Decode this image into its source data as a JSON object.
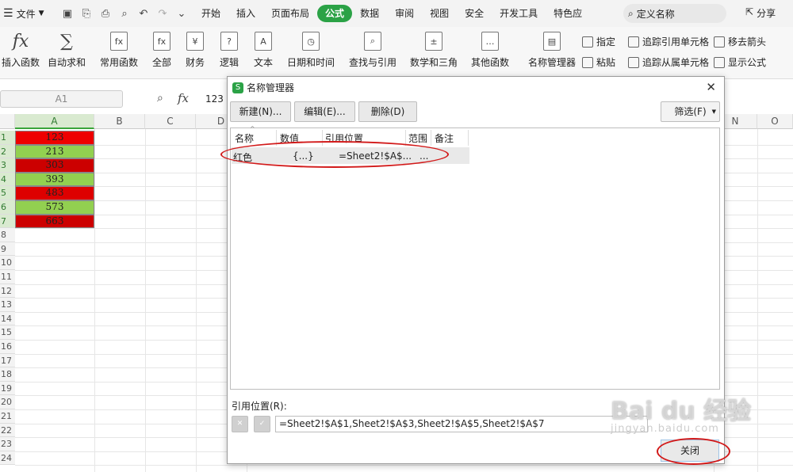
{
  "menubar": {
    "file_label": "文件",
    "tabs": [
      "开始",
      "插入",
      "页面布局",
      "公式",
      "数据",
      "审阅",
      "视图",
      "安全",
      "开发工具",
      "特色应"
    ],
    "active_tab": "公式",
    "search_placeholder": "定义名称",
    "share_label": "分享"
  },
  "ribbon": {
    "buttons": [
      "插入函数",
      "自动求和",
      "常用函数",
      "全部",
      "财务",
      "逻辑",
      "文本",
      "日期和时间",
      "查找与引用",
      "数学和三角",
      "其他函数",
      "名称管理器"
    ],
    "small": [
      "指定",
      "粘贴",
      "追踪引用单元格",
      "追踪从属单元格",
      "移去箭头",
      "显示公式"
    ],
    "fx_glyph": "fx",
    "sum_glyph": "∑"
  },
  "formula_bar": {
    "name_box": "A1",
    "fx_label": "fx",
    "value": "123"
  },
  "sheet": {
    "columns": [
      "A",
      "B",
      "C",
      "D",
      "N",
      "O"
    ],
    "rows": [
      "1",
      "2",
      "3",
      "4",
      "5",
      "6",
      "7",
      "8",
      "9",
      "10",
      "11",
      "12",
      "13",
      "14",
      "15",
      "16",
      "17",
      "18",
      "19",
      "20",
      "21",
      "22",
      "23",
      "24"
    ],
    "cells": [
      {
        "value": "123",
        "color": "#ee0000"
      },
      {
        "value": "213",
        "color": "#92d050"
      },
      {
        "value": "303",
        "color": "#cc0000"
      },
      {
        "value": "393",
        "color": "#92d050"
      },
      {
        "value": "483",
        "color": "#dd0000"
      },
      {
        "value": "573",
        "color": "#92d050"
      },
      {
        "value": "663",
        "color": "#cc0000"
      }
    ]
  },
  "dialog": {
    "title": "名称管理器",
    "logo": "S",
    "close_icon": "✕",
    "new_button": "新建(N)...",
    "edit_button": "编辑(E)...",
    "delete_button": "删除(D)",
    "filter_button": "筛选(F)",
    "headers": [
      "名称",
      "数值",
      "引用位置",
      "范围",
      "备注"
    ],
    "rows": [
      {
        "name": "红色",
        "value": "{...}",
        "ref": "=Sheet2!$A$...",
        "scope": "..."
      }
    ],
    "ref_label": "引用位置(R):",
    "ref_value": "=Sheet2!$A$1,Sheet2!$A$3,Sheet2!$A$5,Sheet2!$A$7",
    "close_button": "关闭"
  },
  "watermark": {
    "main": "Bai du 经验",
    "sub": "jingyan.baidu.com"
  },
  "annotation_color": "#d21a1a"
}
